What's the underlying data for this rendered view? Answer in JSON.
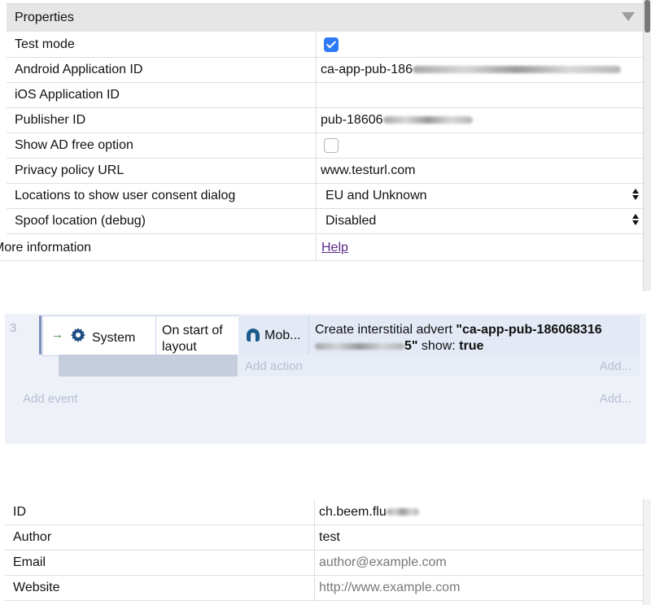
{
  "properties": {
    "header": "Properties",
    "rows": [
      {
        "label": "Test mode",
        "type": "checkbox",
        "checked": true
      },
      {
        "label": "Android Application ID",
        "value": "ca-app-pub-186"
      },
      {
        "label": "iOS Application ID",
        "value": ""
      },
      {
        "label": "Publisher ID",
        "value": "pub-18606"
      },
      {
        "label": "Show AD free option",
        "type": "checkbox",
        "checked": false
      },
      {
        "label": "Privacy policy URL",
        "value": "www.testurl.com"
      },
      {
        "label": "Locations to show user consent dialog",
        "type": "select",
        "value": "EU and Unknown"
      },
      {
        "label": "Spoof location (debug)",
        "type": "select",
        "value": "Disabled"
      },
      {
        "label": "More information",
        "link": "Help"
      }
    ]
  },
  "event_sheet": {
    "event_number": "3",
    "condition": {
      "object": "System",
      "trigger": "On start of layout",
      "arrow": "→"
    },
    "action": {
      "object": "Mob...",
      "text_prefix": "Create interstitial advert ",
      "ad_id": "\"ca-app-pub-186068316",
      "ad_id_end": "5\"",
      "show_label": " show: ",
      "show_value": "true"
    },
    "add_action": "Add action",
    "add_action_more": "Add...",
    "add_event": "Add event",
    "add_event_more": "Add..."
  },
  "project": {
    "rows": [
      {
        "label": "ID",
        "value": "ch.beem.flu"
      },
      {
        "label": "Author",
        "value": "test"
      },
      {
        "label": "Email",
        "placeholder": "author@example.com"
      },
      {
        "label": "Website",
        "placeholder": "http://www.example.com"
      }
    ]
  },
  "colors": {
    "checkbox_on": "#2f7bf5",
    "link": "#5b2a86",
    "event_bg": "#eef1f8"
  }
}
